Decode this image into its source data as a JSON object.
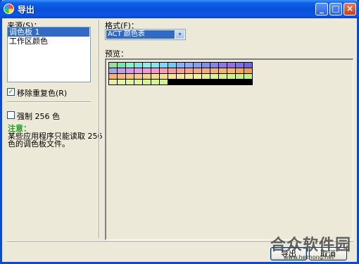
{
  "window": {
    "title": "导出",
    "minimize_glyph": "_",
    "maximize_glyph": "□",
    "close_glyph": "×"
  },
  "source": {
    "label": "来源(S)：",
    "items": [
      "调色板 1",
      "工作区颜色"
    ],
    "selected_index": 0
  },
  "options": {
    "remove_duplicates": {
      "label": "移除重复色(R)",
      "checked": true,
      "mark": "✓"
    },
    "force_colors": {
      "label": "强制 256 色",
      "checked": false
    }
  },
  "note": {
    "title": "注意：",
    "text_line1": "某些应用程序只能读取 256",
    "text_line2": "色的调色板文件。"
  },
  "format": {
    "label": "格式(F)：",
    "selected": "ACT 颜色表",
    "arrow_glyph": "▾"
  },
  "preview": {
    "label": "预览：",
    "swatches": [
      "#9EDC9E",
      "#74E6A8",
      "#8CF0C8",
      "#7CE8E0",
      "#8CECF0",
      "#84E4F4",
      "#7CD8F4",
      "#74C8F4",
      "#7CB4F4",
      "#8CACF4",
      "#84A0F0",
      "#7C90EC",
      "#8484EC",
      "#8C78E8",
      "#9470E8",
      "#7C70E8",
      "#6C64E4",
      "#A4A4EC",
      "#C49CEC",
      "#D49CEC",
      "#E49CE8",
      "#EC9CD8",
      "#F09CC8",
      "#F49CB8",
      "#F49CA8",
      "#F4A0A0",
      "#F4A494",
      "#F4A88C",
      "#F4AC84",
      "#F4B07C",
      "#F4B474",
      "#F4B86C",
      "#F4A85C",
      "#F09C54",
      "#F4B470",
      "#F4BC78",
      "#F4C480",
      "#F4CC84",
      "#F4D488",
      "#F4DC8C",
      "#F4E090",
      "#F4E494",
      "#F4E898",
      "#F4EC98",
      "#F0F098",
      "#E8F094",
      "#E0F090",
      "#D8F08C",
      "#D0F088",
      "#C8F084",
      "#C0F080",
      "#E8F0A0",
      "#E4F49C",
      "#E0F498",
      "#DCF494",
      "#D8F490",
      "#D4F48C",
      "#CCF488"
    ]
  },
  "buttons": {
    "export": "导出",
    "cancel": "取消"
  },
  "watermark": {
    "text": "合众软件园",
    "url": "www.hezhong.net"
  }
}
